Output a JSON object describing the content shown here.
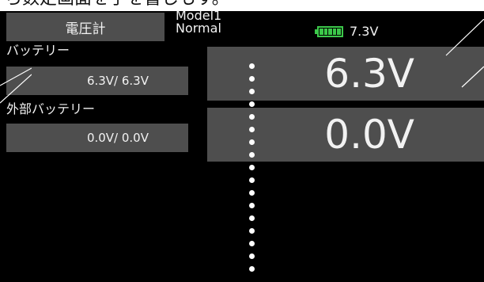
{
  "header": {
    "cropped_caption": "ら数定画面を手を書しもす。",
    "tab_label": "電圧計",
    "model_name": "Model1",
    "condition": "Normal",
    "battery_voltage": "7.3V",
    "battery_level_fraction": 1.0
  },
  "receiver_battery": {
    "label": "バッテリー",
    "value": "6.3V/ 6.3V",
    "big_value": "6.3V"
  },
  "external_battery": {
    "label": "外部バッテリー",
    "value": "0.0V/ 0.0V",
    "big_value": "0.0V"
  },
  "colors": {
    "screen_bg": "#000000",
    "panel": "#4e4e4e",
    "text": "#f2f2f2",
    "battery_green": "#3cc84a"
  },
  "icons": [
    "battery-icon"
  ]
}
